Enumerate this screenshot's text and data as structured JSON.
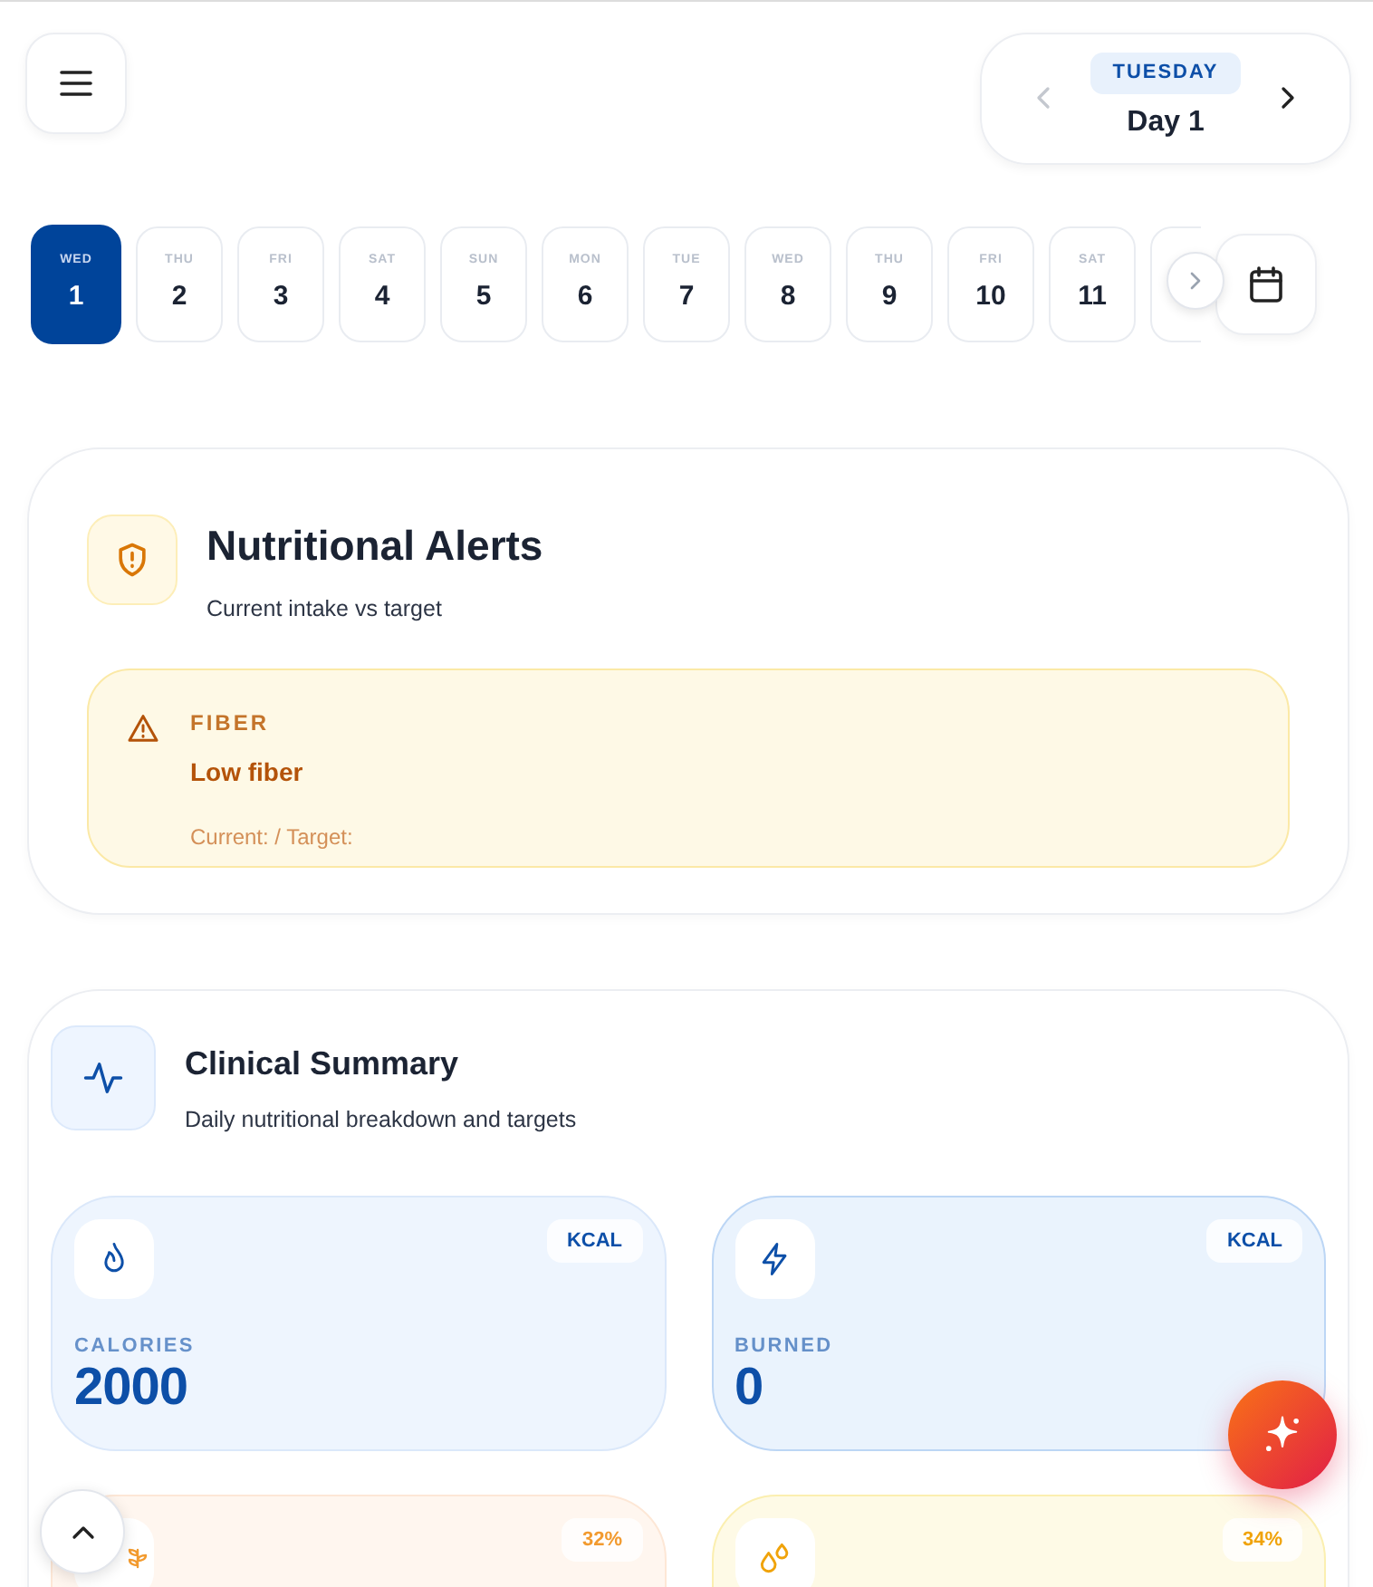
{
  "day_nav": {
    "weekday": "TUESDAY",
    "day": "Day 1",
    "prev_disabled": true
  },
  "days": [
    {
      "weekday": "WED",
      "date": "1",
      "selected": true
    },
    {
      "weekday": "THU",
      "date": "2",
      "selected": false
    },
    {
      "weekday": "FRI",
      "date": "3",
      "selected": false
    },
    {
      "weekday": "SAT",
      "date": "4",
      "selected": false
    },
    {
      "weekday": "SUN",
      "date": "5",
      "selected": false
    },
    {
      "weekday": "MON",
      "date": "6",
      "selected": false
    },
    {
      "weekday": "TUE",
      "date": "7",
      "selected": false
    },
    {
      "weekday": "WED",
      "date": "8",
      "selected": false
    },
    {
      "weekday": "THU",
      "date": "9",
      "selected": false
    },
    {
      "weekday": "FRI",
      "date": "10",
      "selected": false
    },
    {
      "weekday": "SAT",
      "date": "11",
      "selected": false
    }
  ],
  "alerts": {
    "title": "Nutritional Alerts",
    "subtitle": "Current intake vs target",
    "items": [
      {
        "category": "FIBER",
        "message": "Low fiber",
        "detail": "Current: / Target:"
      }
    ]
  },
  "summary": {
    "title": "Clinical Summary",
    "subtitle": "Daily nutritional breakdown and targets",
    "metrics": [
      {
        "kind": "flame",
        "badge": "KCAL",
        "label": "CALORIES",
        "value": "2000",
        "color": "#0d4fa8"
      },
      {
        "kind": "bolt",
        "badge": "KCAL",
        "label": "BURNED",
        "value": "0",
        "color": "#0d4fa8"
      },
      {
        "kind": "grain",
        "badge": "32%",
        "color": "#f29a2e"
      },
      {
        "kind": "drops",
        "badge": "34%",
        "color": "#f0a30a"
      }
    ]
  }
}
